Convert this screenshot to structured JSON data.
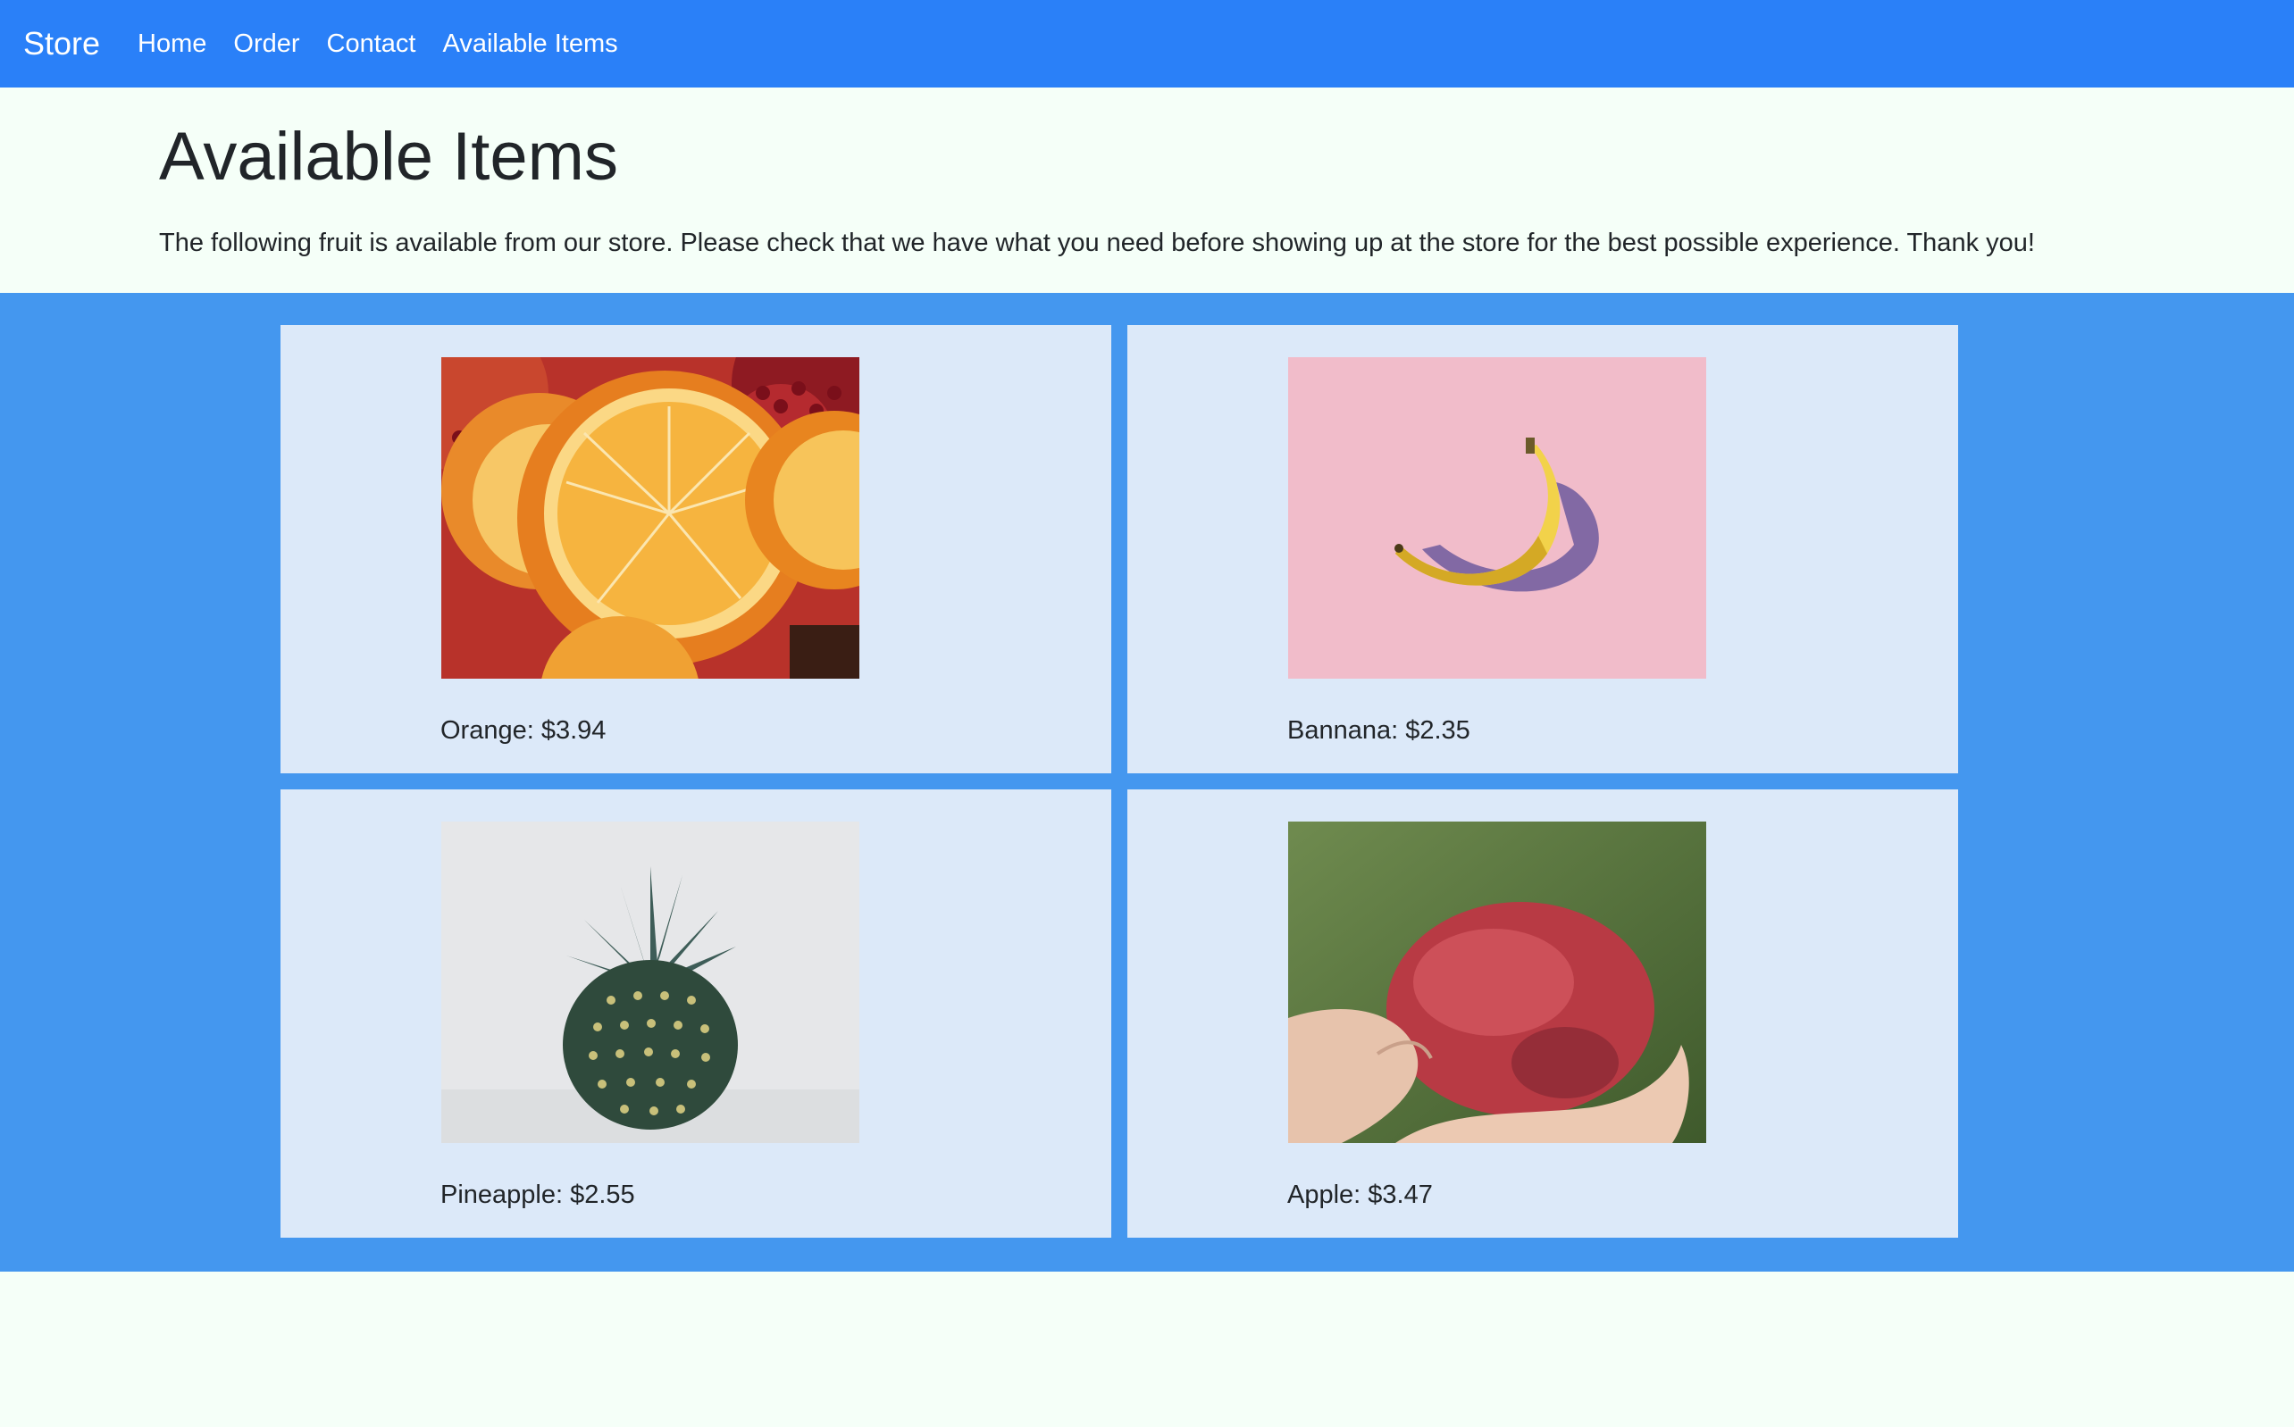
{
  "navbar": {
    "brand": "Store",
    "links": [
      "Home",
      "Order",
      "Contact",
      "Available Items"
    ]
  },
  "header": {
    "title": "Available Items",
    "intro": "The following fruit is available from our store. Please check that we have what you need before showing up at the store for the best possible experience. Thank you!"
  },
  "items": [
    {
      "caption": "Orange: $3.94",
      "image": "orange-photo"
    },
    {
      "caption": "Bannana: $2.35",
      "image": "banana-photo"
    },
    {
      "caption": "Pineapple: $2.55",
      "image": "pineapple-photo"
    },
    {
      "caption": "Apple: $3.47",
      "image": "apple-photo"
    }
  ],
  "colors": {
    "navbar": "#2a80f8",
    "page_background": "#f5fff8",
    "band": "#4497ef",
    "card": "#dce9f9"
  }
}
